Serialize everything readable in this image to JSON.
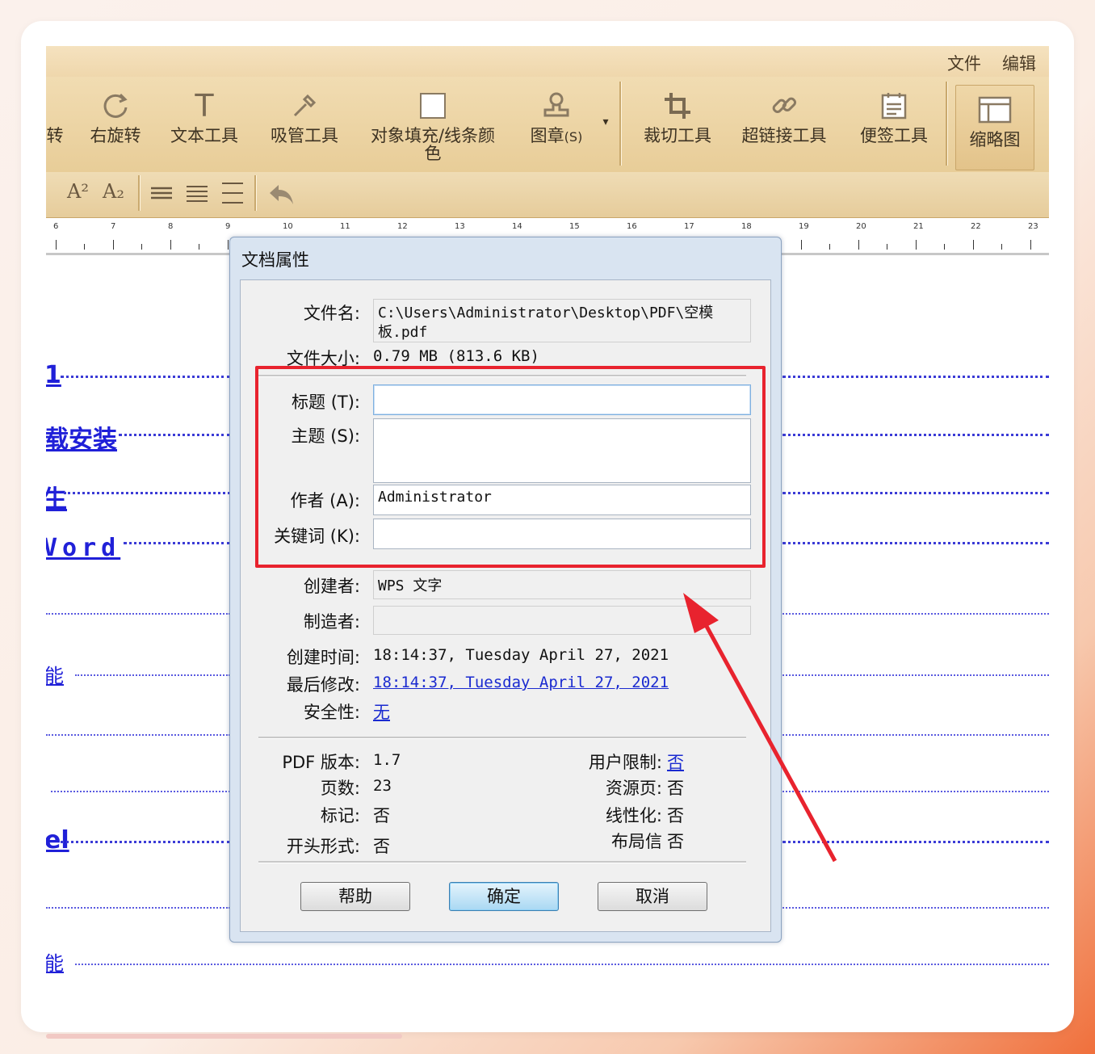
{
  "menu": {
    "file": "文件",
    "edit": "编辑"
  },
  "ribbon": {
    "tools": [
      {
        "label": "转",
        "icon": "rotate-left-icon"
      },
      {
        "label": "右旋转",
        "icon": "rotate-right-icon"
      },
      {
        "label": "文本工具",
        "icon": "text-tool-icon"
      },
      {
        "label": "吸管工具",
        "icon": "eyedropper-icon"
      },
      {
        "label1": "对象填充/线条颜",
        "label2": "色",
        "icon": "fill-color-icon"
      },
      {
        "label": "图章",
        "hotkey": "(S)",
        "icon": "stamp-icon"
      },
      {
        "label": "裁切工具",
        "icon": "crop-icon"
      },
      {
        "label": "超链接工具",
        "icon": "hyperlink-icon"
      },
      {
        "label": "便签工具",
        "icon": "note-icon"
      },
      {
        "label": "缩略图",
        "icon": "thumbnail-icon"
      }
    ],
    "row2": {
      "superscript": "A²",
      "subscript": "A₂"
    }
  },
  "ruler": [
    "6",
    "7",
    "8",
    "9",
    "10",
    "11",
    "12",
    "13",
    "14",
    "15",
    "16",
    "17",
    "18",
    "19",
    "20",
    "21",
    "22",
    "23"
  ],
  "document": {
    "lines": [
      "1",
      "载安装",
      "生",
      "Vord",
      "能",
      "",
      "el",
      "能"
    ]
  },
  "dialog": {
    "title": "文档属性",
    "filename_label": "文件名:",
    "filename_value_1": "C:\\Users\\Administrator\\Desktop\\PDF\\空模",
    "filename_value_2": "板.pdf",
    "filesize_label": "文件大小:",
    "filesize_value": "0.79 MB (813.6 KB)",
    "title_label": "标题 (T):",
    "title_value": "",
    "subject_label": "主题 (S):",
    "subject_value": "",
    "author_label": "作者 (A):",
    "author_value": "Administrator",
    "keywords_label": "关键词 (K):",
    "keywords_value": "",
    "creator_label": "创建者:",
    "creator_value": "WPS 文字",
    "producer_label": "制造者:",
    "producer_value": "",
    "created_label": "创建时间:",
    "created_value": "18:14:37, Tuesday April 27, 2021",
    "modified_label": "最后修改:",
    "modified_value": "18:14:37, Tuesday April 27, 2021",
    "security_label": "安全性:",
    "security_value": "无",
    "pdf_version_label": "PDF 版本:",
    "pdf_version_value": "1.7",
    "pages_label": "页数:",
    "pages_value": "23",
    "tagged_label": "标记:",
    "tagged_value": "否",
    "open_mode_label": "开头形式:",
    "open_mode_value": "否",
    "user_restrict_label": "用户限制:",
    "user_restrict_value": "否",
    "resource_label": "资源页:",
    "resource_value": "否",
    "linearized_label": "线性化:",
    "linearized_value": "否",
    "layout_label": "布局信",
    "layout_value": "否",
    "help_button": "帮助",
    "ok_button": "确定",
    "cancel_button": "取消"
  },
  "colors": {
    "annotation": "#e8232e",
    "link": "#1a2ad0",
    "toolbar": "#efd7ac"
  }
}
